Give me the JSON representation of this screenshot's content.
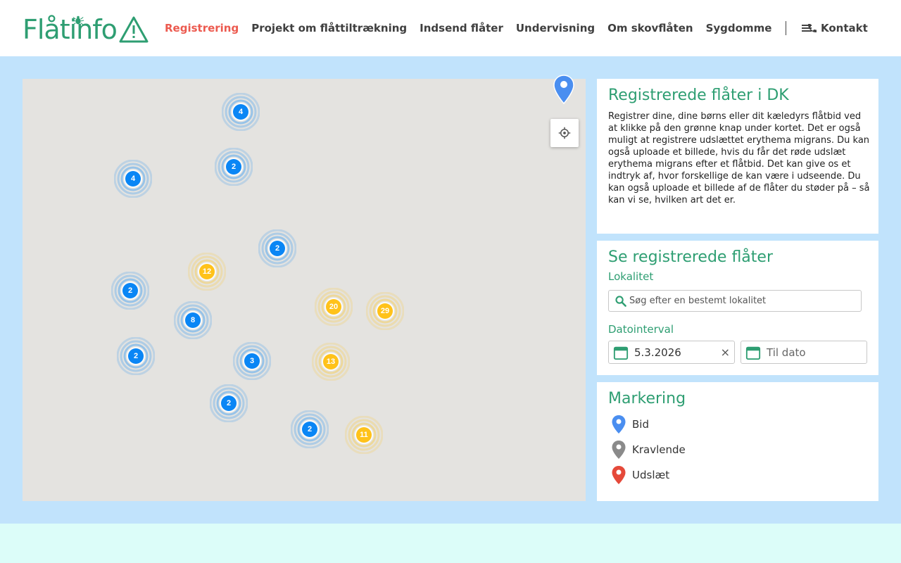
{
  "header": {
    "logo_text": "Flåtinfo",
    "nav": [
      {
        "label": "Registrering",
        "active": true
      },
      {
        "label": "Projekt om flåttiltrækning",
        "active": false
      },
      {
        "label": "Indsend flåter",
        "active": false
      },
      {
        "label": "Undervisning",
        "active": false
      },
      {
        "label": "Om skovflåten",
        "active": false
      },
      {
        "label": "Sygdomme",
        "active": false
      }
    ],
    "contact_label": "Kontakt"
  },
  "map": {
    "clusters": [
      {
        "count": "4",
        "color": "blue"
      },
      {
        "count": "2",
        "color": "blue"
      },
      {
        "count": "4",
        "color": "blue"
      },
      {
        "count": "2",
        "color": "blue"
      },
      {
        "count": "12",
        "color": "yellow"
      },
      {
        "count": "2",
        "color": "blue"
      },
      {
        "count": "20",
        "color": "yellow"
      },
      {
        "count": "29",
        "color": "yellow"
      },
      {
        "count": "8",
        "color": "blue"
      },
      {
        "count": "2",
        "color": "blue"
      },
      {
        "count": "3",
        "color": "blue"
      },
      {
        "count": "13",
        "color": "yellow"
      },
      {
        "count": "2",
        "color": "blue"
      },
      {
        "count": "2",
        "color": "blue"
      },
      {
        "count": "11",
        "color": "yellow"
      }
    ]
  },
  "info_panel": {
    "title": "Registrerede flåter i DK",
    "description": "Registrer dine, dine børns eller dit kæledyrs flåtbid ved at klikke på den grønne knap under kortet. Det er også muligt at registrere udslættet erythema migrans. Du kan også uploade et billede, hvis du får det røde udslæt erythema migrans efter et flåtbid. Det kan give os et indtryk af, hvor forskellige de kan være i udseende. Du kan også uploade et billede af de flåter du støder på – så kan vi se, hvilken art det er."
  },
  "filter_panel": {
    "title": "Se registrerede flåter",
    "location_label": "Lokalitet",
    "search_placeholder": "Søg efter en bestemt lokalitet",
    "date_label": "Datointerval",
    "date_from": "5.3.2026",
    "date_clear": "×",
    "date_to_placeholder": "Til dato"
  },
  "legend_panel": {
    "title": "Markering",
    "items": [
      {
        "label": "Bid",
        "color": "#4a8ef0"
      },
      {
        "label": "Kravlende",
        "color": "#8a8a8a"
      },
      {
        "label": "Udslæt",
        "color": "#e5493a"
      }
    ]
  },
  "colors": {
    "brand_green": "#2e9e72",
    "active_nav": "#ec5a4f",
    "cluster_blue": "#0a86f5",
    "cluster_yellow": "#ffc21a"
  }
}
